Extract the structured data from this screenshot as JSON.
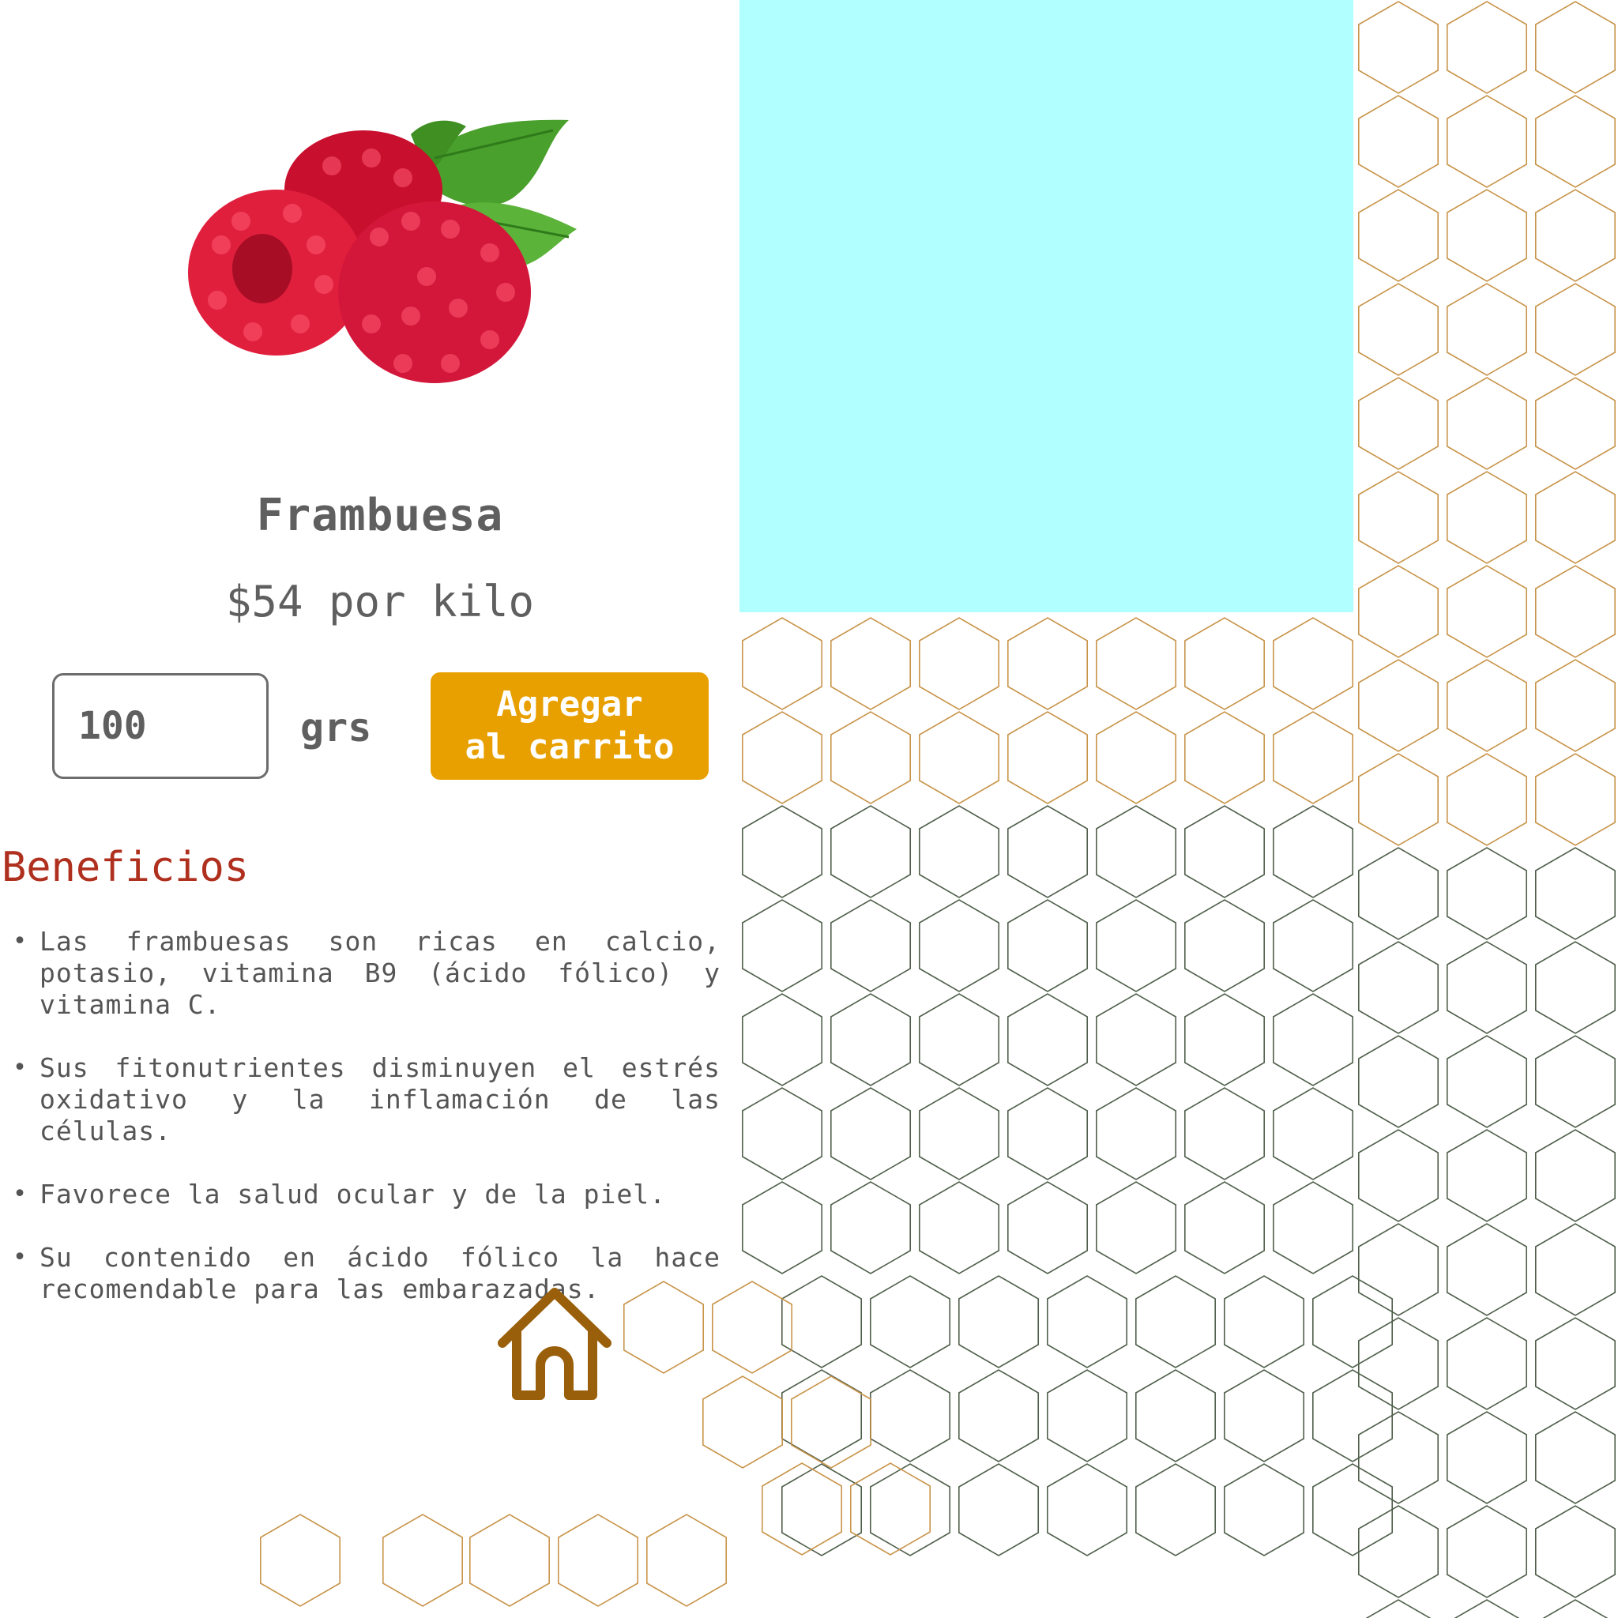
{
  "product": {
    "name": "Frambuesa",
    "price": "$54 por kilo",
    "image": "raspberries-image"
  },
  "order": {
    "quantity": "100",
    "unit": "grs",
    "add_button_label": "Agregar\nal carrito"
  },
  "benefits": {
    "title": "Beneficios",
    "items": [
      "Las frambuesas son ricas en calcio, potasio, vitamina B9 (ácido fólico) y vitamina C.",
      "Sus fitonutrientes disminuyen el estrés oxidativo y la inflamación de las células.",
      "Favorece la salud ocular y de la piel.",
      "Su contenido en ácido fólico la hace recomendable para las embarazadas."
    ]
  },
  "nav": {
    "home_icon": "home-icon"
  },
  "colors": {
    "hero_panel": "#b1ffff",
    "accent_button": "#e8a000",
    "benefits_title": "#b0301f",
    "text_gray": "#5f5f5f",
    "hex_gold": "#c8944a",
    "hex_green": "#4f5f4a",
    "home_icon": "#9a5f0a"
  }
}
